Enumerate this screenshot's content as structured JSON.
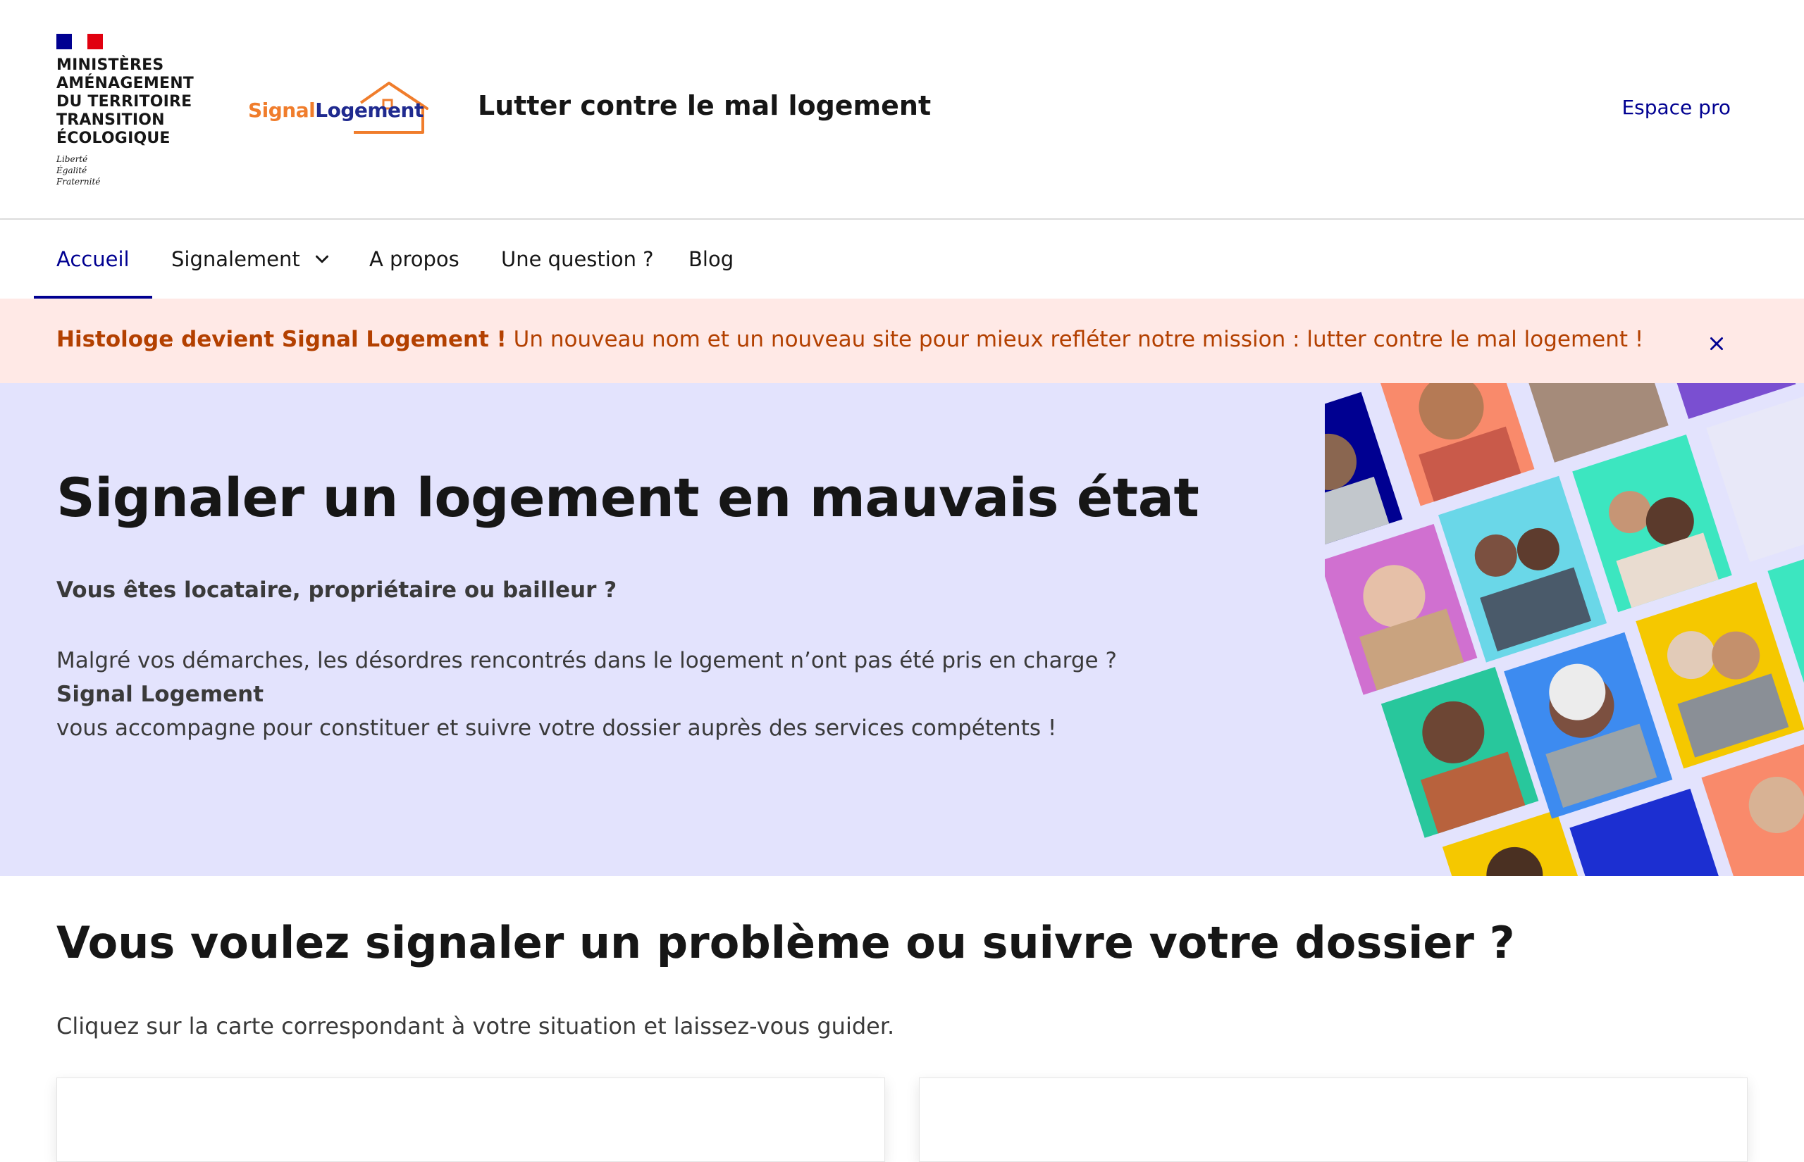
{
  "header": {
    "ministry_lines": [
      "MINISTÈRES",
      "AMÉNAGEMENT",
      "DU TERRITOIRE",
      "TRANSITION",
      "ÉCOLOGIQUE"
    ],
    "motto": [
      "Liberté",
      "Égalité",
      "Fraternité"
    ],
    "logo_signal": "Signal",
    "logo_logement": "Logement",
    "service_title": "Lutter contre le mal logement",
    "espace_pro": "Espace pro"
  },
  "nav": {
    "items": [
      {
        "label": "Accueil",
        "active": true
      },
      {
        "label": "Signalement",
        "active": false,
        "dropdown": true
      },
      {
        "label": "A propos",
        "active": false
      },
      {
        "label": "Une question ?",
        "active": false
      },
      {
        "label": "Blog",
        "active": false
      }
    ]
  },
  "notice": {
    "strong": "Histologe devient Signal Logement !",
    "text": " Un nouveau nom et un nouveau site pour mieux refléter notre mission : lutter contre le mal logement !",
    "close_icon": "close-icon"
  },
  "hero": {
    "title": "Signaler un logement en mauvais état",
    "question": "Vous êtes locataire, propriétaire ou bailleur ?",
    "body_line1": "Malgré vos démarches, les désordres rencontrés dans le logement n’ont pas été pris en charge ?",
    "body_line2_strong": "Signal Logement",
    "body_line2": " vous accompagne pour constituer et suivre votre dossier auprès des services compétents !"
  },
  "section": {
    "title": "Vous voulez signaler un problème ou suivre votre dossier ?",
    "subtitle": "Cliquez sur la carte correspondant à votre situation et laissez-vous guider."
  },
  "colors": {
    "accent": "#000091",
    "notice_bg": "#ffe9e6",
    "notice_text": "#b34000",
    "hero_bg": "#e3e3fd",
    "logo_orange": "#f07d2c"
  }
}
